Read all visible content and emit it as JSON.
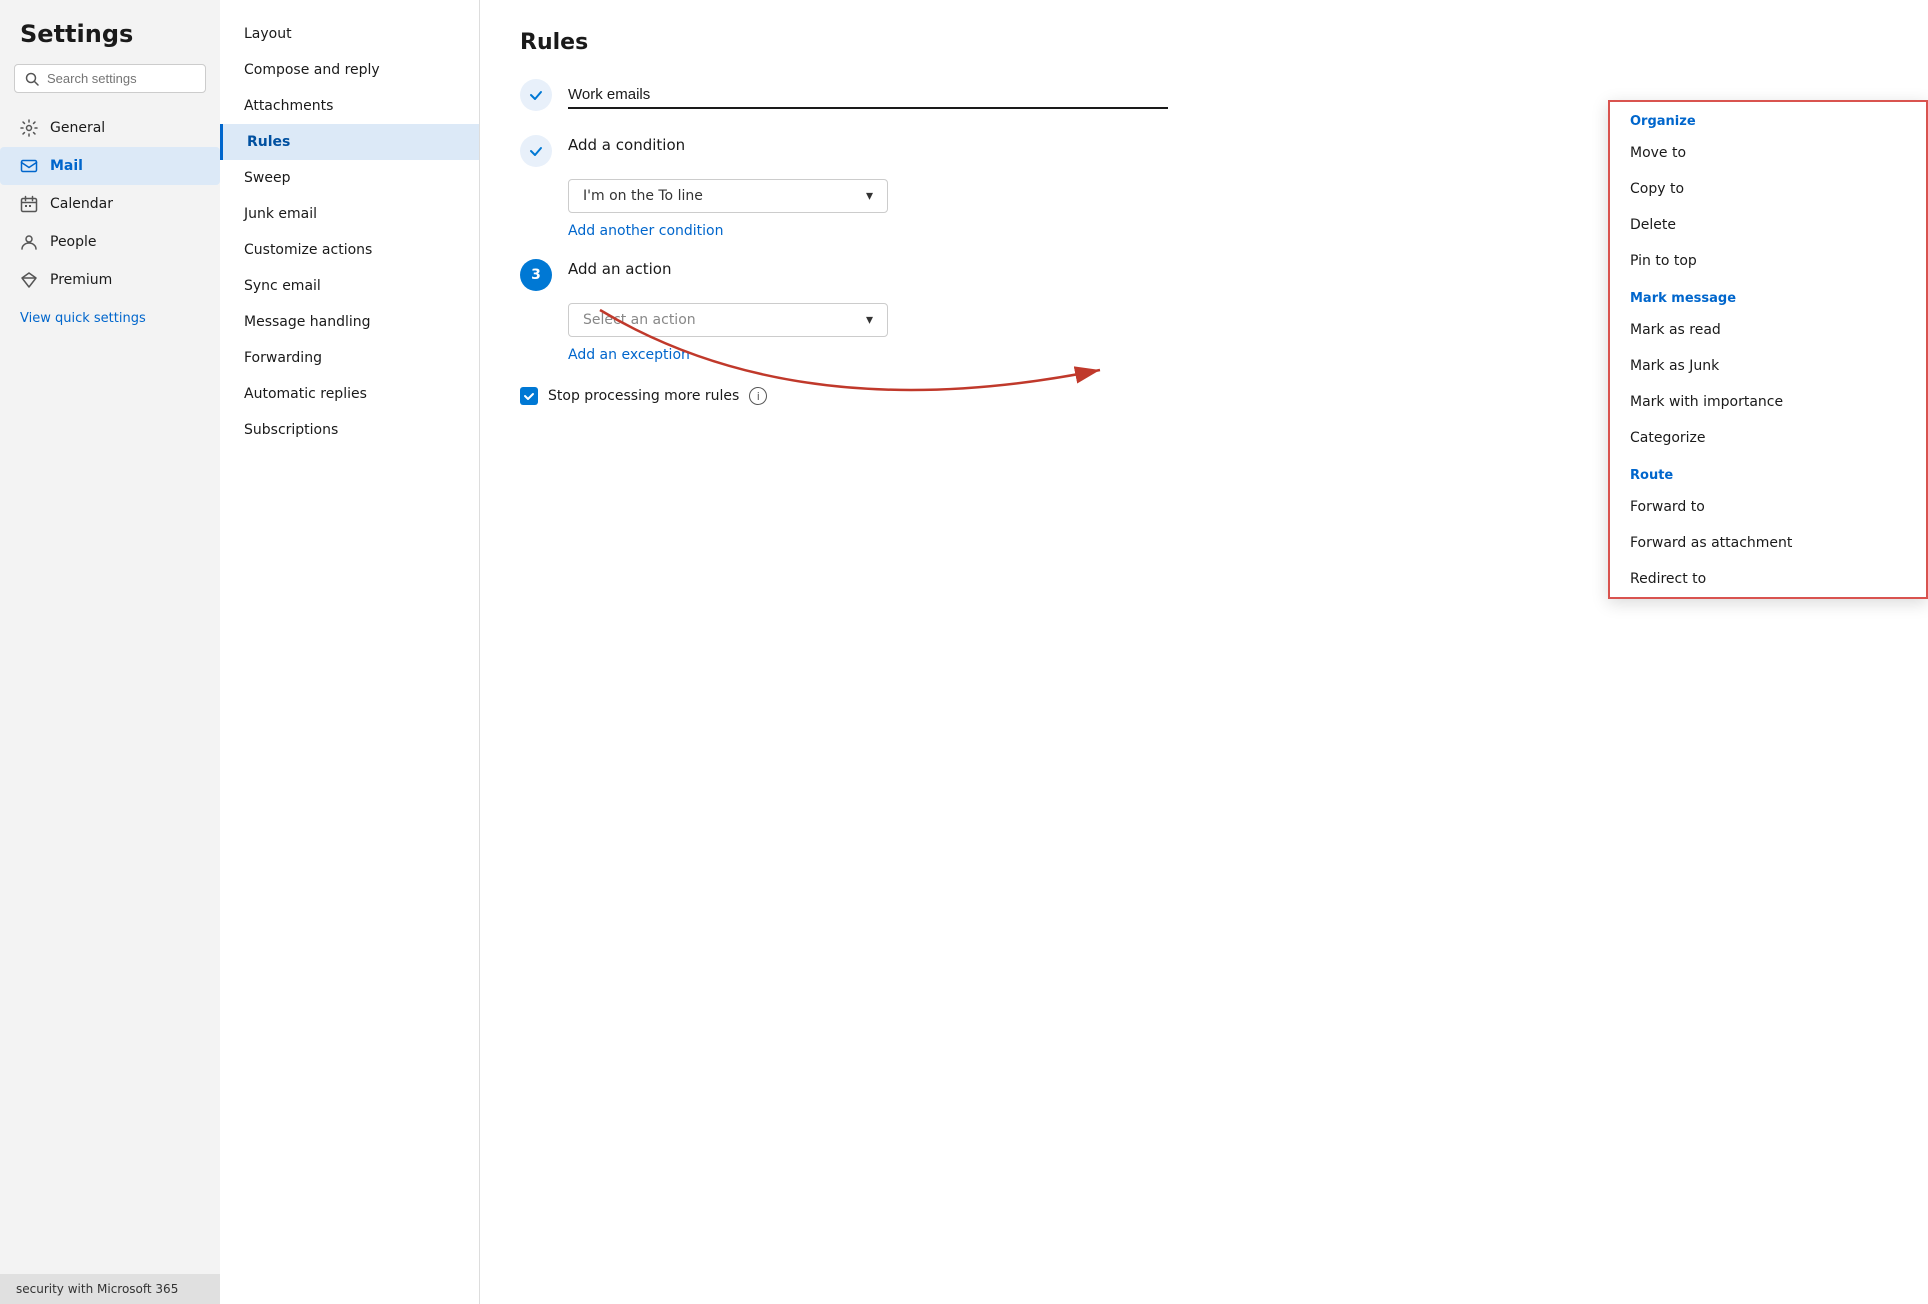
{
  "sidebar": {
    "title": "Settings",
    "search_placeholder": "Search settings",
    "nav_items": [
      {
        "id": "general",
        "label": "General",
        "icon": "gear"
      },
      {
        "id": "mail",
        "label": "Mail",
        "icon": "mail",
        "active": true
      },
      {
        "id": "calendar",
        "label": "Calendar",
        "icon": "calendar"
      },
      {
        "id": "people",
        "label": "People",
        "icon": "people"
      },
      {
        "id": "premium",
        "label": "Premium",
        "icon": "diamond"
      }
    ],
    "quick_settings_link": "View quick settings"
  },
  "middle_col": {
    "items": [
      {
        "id": "layout",
        "label": "Layout"
      },
      {
        "id": "compose",
        "label": "Compose and reply"
      },
      {
        "id": "attachments",
        "label": "Attachments"
      },
      {
        "id": "rules",
        "label": "Rules",
        "active": true
      },
      {
        "id": "sweep",
        "label": "Sweep"
      },
      {
        "id": "junk",
        "label": "Junk email"
      },
      {
        "id": "customize",
        "label": "Customize actions"
      },
      {
        "id": "sync",
        "label": "Sync email"
      },
      {
        "id": "handling",
        "label": "Message handling"
      },
      {
        "id": "forwarding",
        "label": "Forwarding"
      },
      {
        "id": "auto",
        "label": "Automatic replies"
      },
      {
        "id": "subscriptions",
        "label": "Subscriptions"
      }
    ]
  },
  "main": {
    "title": "Rules",
    "rule_name_value": "Work emails",
    "rule_name_placeholder": "Work emails",
    "condition_label": "Add a condition",
    "condition_value": "I'm on the To line",
    "add_condition_link": "Add another condition",
    "action_step": "3",
    "action_label": "Add an action",
    "action_placeholder": "Select an action",
    "add_exception_link": "Add an exception",
    "stop_processing_label": "Stop processing more rules",
    "stop_processing_checked": true
  },
  "action_popup": {
    "sections": [
      {
        "header": "Organize",
        "items": [
          "Move to",
          "Copy to",
          "Delete",
          "Pin to top"
        ]
      },
      {
        "header": "Mark message",
        "items": [
          "Mark as read",
          "Mark as Junk",
          "Mark with importance",
          "Categorize"
        ]
      },
      {
        "header": "Route",
        "items": [
          "Forward to",
          "Forward as attachment",
          "Redirect to"
        ]
      }
    ]
  },
  "bottom_bar": {
    "text": "security with Microsoft 365"
  },
  "colors": {
    "accent_blue": "#0078d4",
    "link_blue": "#0066cc",
    "active_bg": "#dce9f7",
    "popup_border": "#d9534f",
    "arrow_color": "#c0392b"
  }
}
